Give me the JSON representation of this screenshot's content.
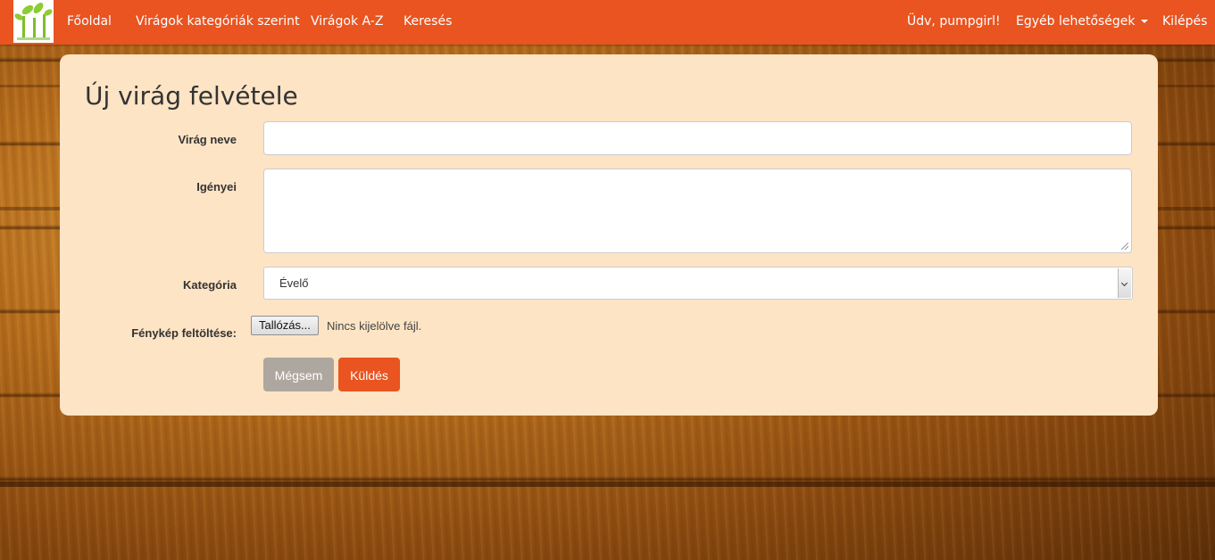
{
  "nav": {
    "logo_alt": "Virág logó",
    "home": "Főoldal",
    "by_category": "Virágok kategóriák szerint",
    "a_z": "Virágok A-Z",
    "search": "Keresés",
    "greeting": "Üdv, pumpgirl!",
    "more_options": "Egyéb lehetőségek",
    "logout": "Kilépés"
  },
  "form": {
    "title": "Új virág felvétele",
    "name_label": "Virág neve",
    "name_value": "",
    "needs_label": "Igényei",
    "needs_value": "",
    "category_label": "Kategória",
    "category_selected": "Évelő",
    "photo_label": "Fénykép feltöltése:",
    "browse_button": "Tallózás...",
    "no_file_text": "Nincs kijelölve fájl.",
    "cancel_button": "Mégsem",
    "submit_button": "Küldés"
  },
  "colors": {
    "navbar": "#e95420",
    "panel": "#fde4c5",
    "cancel_button": "#aea79f",
    "submit_button": "#e95420"
  }
}
